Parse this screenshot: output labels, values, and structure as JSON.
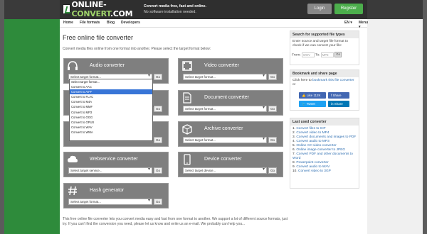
{
  "header": {
    "tagline1": "Convert media free, fast and online.",
    "tagline2": "No software installation needed.",
    "login": "Login",
    "register": "Register",
    "logo_text_a": "ONLINE-",
    "logo_text_b": "CONVERT",
    "logo_text_c": ".COM"
  },
  "nav": {
    "home": "Home",
    "file_formats": "File formats",
    "blog": "Blog",
    "developers": "Developers",
    "lang": "EN",
    "menu": "Menu"
  },
  "main": {
    "title": "Free online file converter",
    "intro": "Convert media files online from one format into another. Please select the target format below:",
    "converters": [
      {
        "title": "Audio converter",
        "select": "Select target format..."
      },
      {
        "title": "Video converter",
        "select": "Select target format..."
      },
      {
        "title": "Document converter",
        "select": "Select target format..."
      },
      {
        "title": "Archive converter",
        "select": "Select target format..."
      },
      {
        "title": "Webservice converter",
        "select": "Select target service..."
      },
      {
        "title": "Device converter",
        "select": "Select target device..."
      },
      {
        "title": "Hash generator",
        "select": "Select target format..."
      }
    ],
    "go_label": "Go",
    "dropdown_options": [
      "Select target format...",
      "Convert to AAC",
      "Convert to AIFF",
      "Convert to FLAC",
      "Convert to M4A",
      "Convert to MMF",
      "Convert to MP3",
      "Convert to OGG",
      "Convert to OPUS",
      "Convert to WAV",
      "Convert to WMA"
    ],
    "dropdown_selected_index": 2,
    "footer": "This free online file converter lets you convert media easy and fast from one format to another. We support a lot of different source formats, just try. If you can't find the conversion you need, please let us know and write us an e-mail. We probably can help you..."
  },
  "sidebar": {
    "search": {
      "head": "Search for supported file types",
      "text": "Enter source and target file format to check if we can convert your file:",
      "from_label": "From:",
      "from_placeholder": "WOV",
      "to_label": "To:",
      "to_placeholder": "MP3",
      "go": "Go"
    },
    "bookmark": {
      "head": "Bookmark and share page",
      "text_a": "Click here to ",
      "text_link": "bookmark this file converter",
      "text_b": " or",
      "like": "Like 112K",
      "share_fb": "Share",
      "tweet": "Tweet",
      "share_li": "Share"
    },
    "last_used": {
      "head": "Last used converter",
      "items": [
        "Convert files to GIF",
        "Convert video to MP4",
        "Convert documents and images to PDF",
        "Convert audio to MP3",
        "Online AVI video converter",
        "Online image converter to JPEG",
        "Convert PDF and other documents to Word",
        "Powerpoint converter",
        "Convert audio to WAV",
        "Convert video to 3GP"
      ]
    }
  },
  "colors": {
    "brand_green": "#2e8b3b",
    "panel_gray": "#7f7f7f",
    "register_green": "#4cae4c",
    "link_blue": "#2b6cb0"
  }
}
